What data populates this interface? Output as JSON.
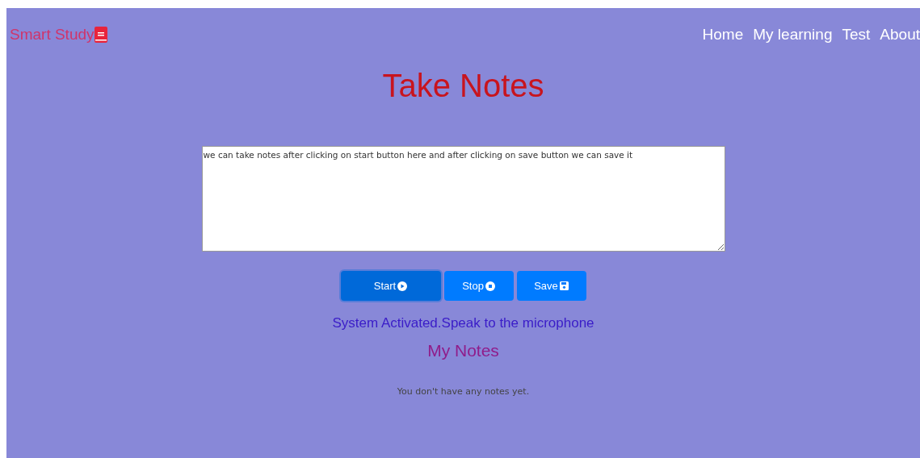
{
  "brand": {
    "name": "Smart Study"
  },
  "nav": [
    {
      "label": "Home"
    },
    {
      "label": "My learning"
    },
    {
      "label": "Test"
    },
    {
      "label": "About"
    }
  ],
  "title": "Take Notes",
  "notes_field": {
    "value": "we can take notes after clicking on start button here and after clicking on save button we can save it"
  },
  "buttons": [
    {
      "label": "Start",
      "kind": "play",
      "active": true
    },
    {
      "label": "Stop",
      "kind": "stop",
      "active": false
    },
    {
      "label": "Save",
      "kind": "save",
      "active": false
    }
  ],
  "status": "System Activated.Speak to the microphone",
  "notes_heading": "My Notes",
  "empty_message": "You don't have any notes yet."
}
